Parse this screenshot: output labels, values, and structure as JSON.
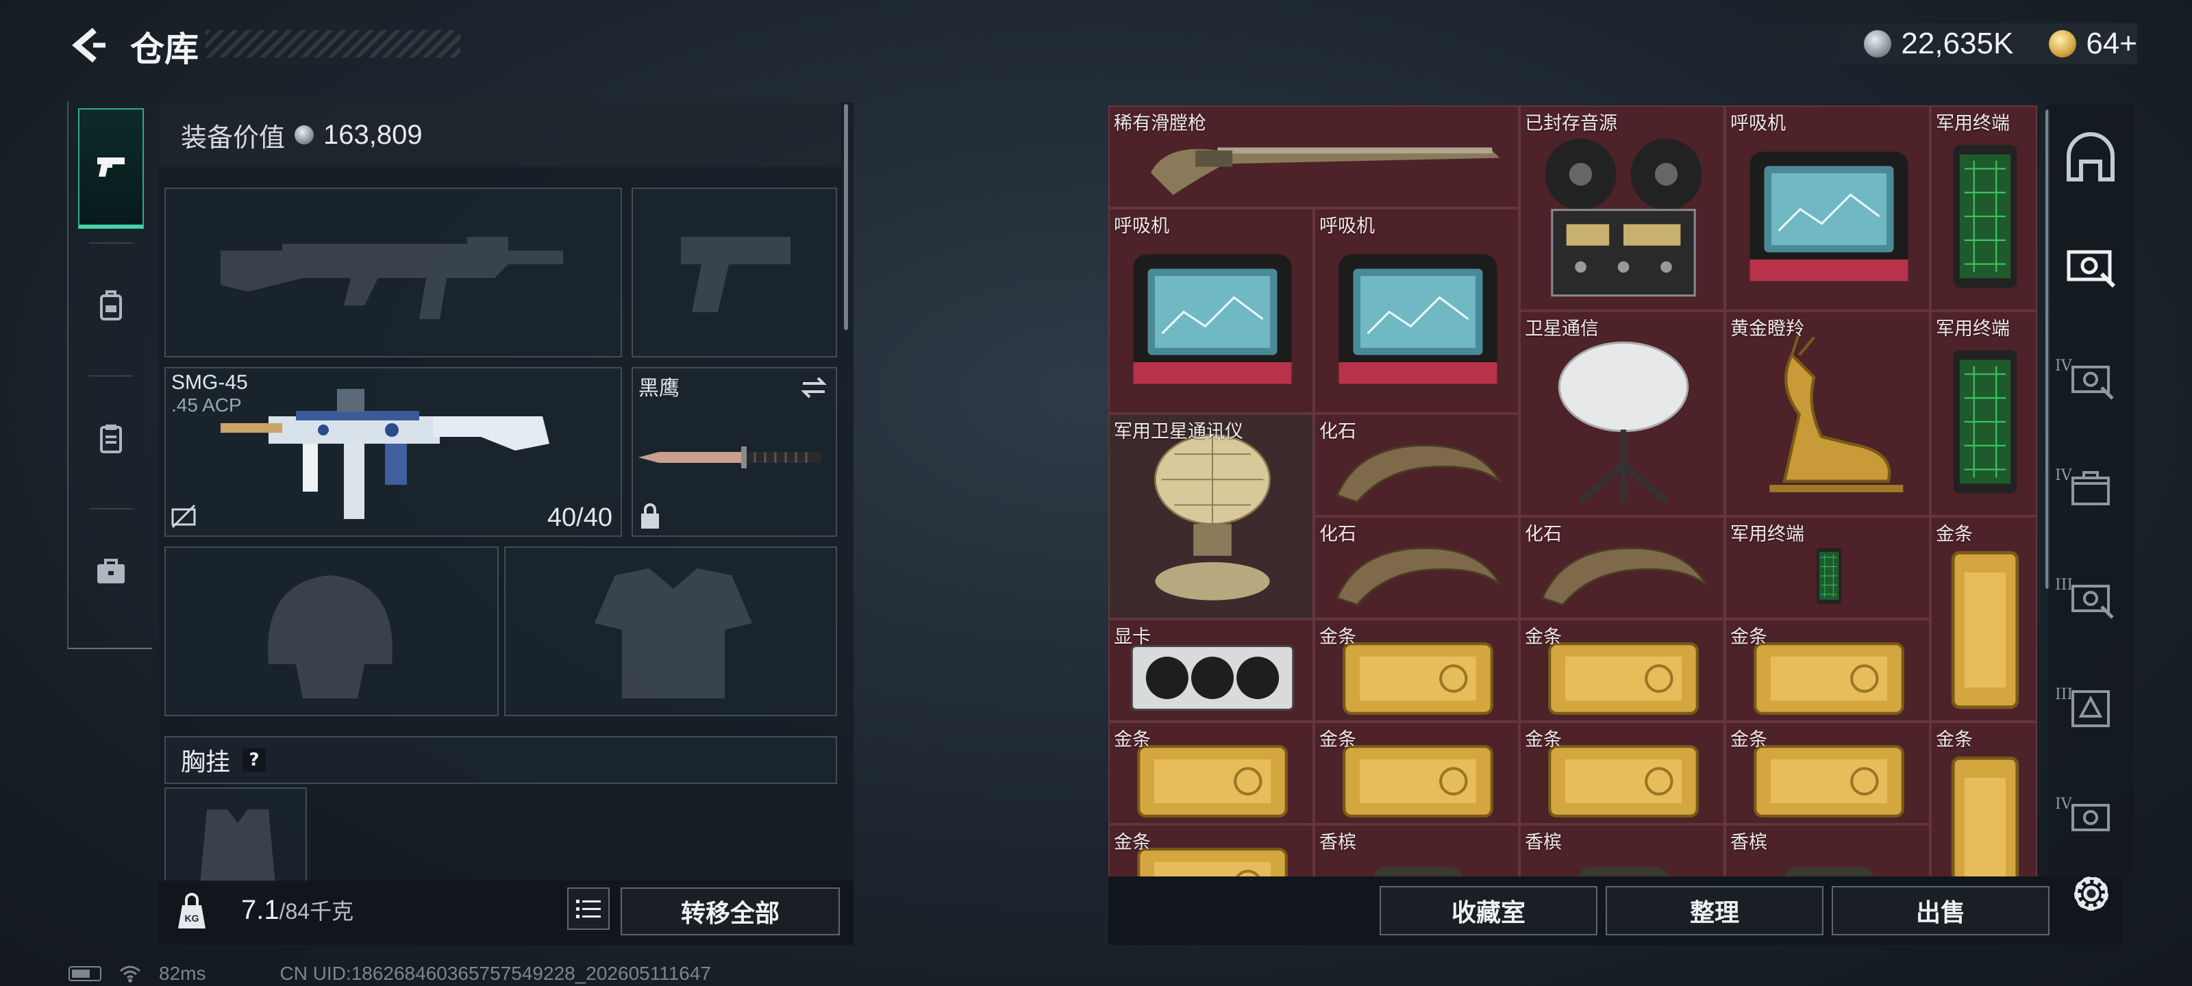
{
  "header": {
    "title": "仓库",
    "currency": [
      {
        "icon": "silver-coin-icon",
        "value": "22,635K"
      },
      {
        "icon": "gold-coin-icon",
        "value": "64+"
      }
    ]
  },
  "left_tabs": [
    {
      "name": "weapons",
      "icon": "pistol-icon",
      "active": true
    },
    {
      "name": "backpack",
      "icon": "backpack-icon",
      "active": false
    },
    {
      "name": "armor",
      "icon": "clipboard-icon",
      "active": false
    },
    {
      "name": "toolkit",
      "icon": "briefcase-icon",
      "active": false
    }
  ],
  "loadout": {
    "value_label": "装备价值",
    "value": "163,809",
    "primary": {
      "name": "SMG-45",
      "ammo": ".45 ACP",
      "count": "40/40"
    },
    "melee": {
      "name": "黑鹰"
    },
    "chest_rig_label": "胸挂",
    "chest_rig_help": "?"
  },
  "weight": {
    "current": "7.1",
    "max": "/84千克"
  },
  "buttons": {
    "transfer_all": "转移全部",
    "collection": "收藏室",
    "sort": "整理",
    "sell": "出售"
  },
  "status": {
    "ping": "82ms",
    "uid": "CN UID:1862684603657575492​28_202605111647"
  },
  "storage": {
    "items": [
      {
        "label": "稀有滑膛枪",
        "icon": "musket-icon"
      },
      {
        "label": "已封存音源",
        "icon": "reel-tape-recorder-icon"
      },
      {
        "label": "呼吸机",
        "icon": "ventilator-icon"
      },
      {
        "label": "军用终端",
        "icon": "military-terminal-icon"
      },
      {
        "label": "呼吸机",
        "icon": "ventilator-icon"
      },
      {
        "label": "呼吸机",
        "icon": "ventilator-icon"
      },
      {
        "label": "卫星通信",
        "icon": "satellite-dish-icon"
      },
      {
        "label": "黄金瞪羚",
        "icon": "golden-gazelle-icon"
      },
      {
        "label": "军用终端",
        "icon": "military-terminal-icon"
      },
      {
        "label": "军用卫星通讯仪",
        "icon": "military-satellite-comm-icon"
      },
      {
        "label": "化石",
        "icon": "fossil-claw-icon"
      },
      {
        "label": "化石",
        "icon": "fossil-claw-icon"
      },
      {
        "label": "化石",
        "icon": "fossil-claw-icon"
      },
      {
        "label": "军用终端",
        "icon": "military-terminal-icon"
      },
      {
        "label": "金条",
        "icon": "gold-bar-icon"
      },
      {
        "label": "显卡",
        "icon": "graphics-card-icon"
      },
      {
        "label": "金条",
        "icon": "gold-bar-icon"
      },
      {
        "label": "金条",
        "icon": "gold-bar-icon"
      },
      {
        "label": "金条",
        "icon": "gold-bar-icon"
      },
      {
        "label": "金条",
        "icon": "gold-bar-icon"
      },
      {
        "label": "金条",
        "icon": "gold-bar-icon"
      },
      {
        "label": "金条",
        "icon": "gold-bar-icon"
      },
      {
        "label": "金条",
        "icon": "gold-bar-icon"
      },
      {
        "label": "金条",
        "icon": "gold-bar-icon"
      },
      {
        "label": "金条",
        "icon": "gold-bar-icon"
      },
      {
        "label": "香槟",
        "icon": "champagne-icon"
      },
      {
        "label": "香槟",
        "icon": "champagne-icon"
      },
      {
        "label": "香槟",
        "icon": "champagne-icon"
      }
    ]
  },
  "right_rail": [
    {
      "icon": "bunker-icon",
      "level": ""
    },
    {
      "icon": "workbench-icon",
      "level": ""
    },
    {
      "icon": "workbench-icon",
      "level": "IV"
    },
    {
      "icon": "medical-station-icon",
      "level": "IV"
    },
    {
      "icon": "workbench-icon",
      "level": "III"
    },
    {
      "icon": "armor-station-icon",
      "level": "III"
    },
    {
      "icon": "workbench-icon",
      "level": "IV"
    }
  ],
  "colors": {
    "accent": "#44d6a8",
    "storage_bg": "#4d2229",
    "panel_bg": "#141c24"
  }
}
